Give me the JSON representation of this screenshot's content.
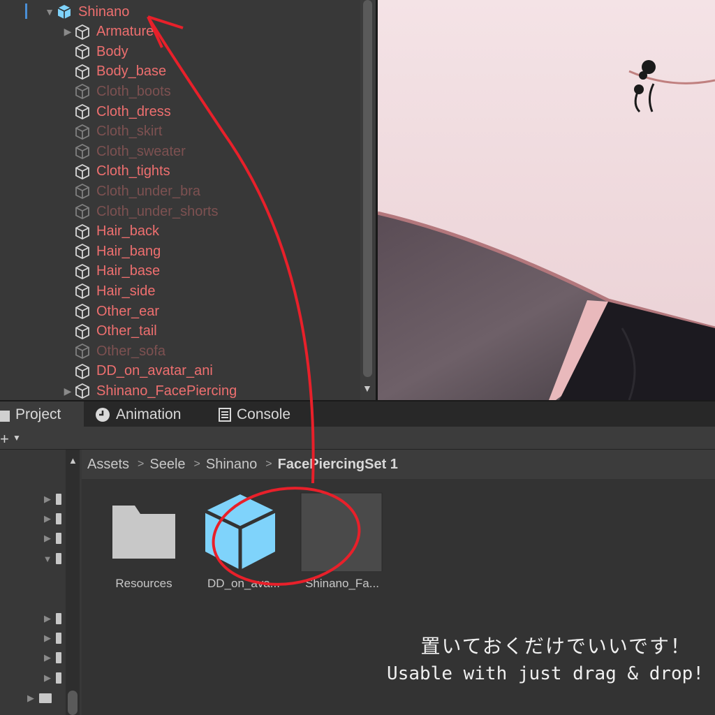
{
  "hierarchy": {
    "items": [
      {
        "label": "Shinano",
        "state": "root",
        "arrow": "down",
        "indent": 0
      },
      {
        "label": "Armature",
        "state": "active",
        "arrow": "right",
        "indent": 1
      },
      {
        "label": "Body",
        "state": "active",
        "arrow": "",
        "indent": 1
      },
      {
        "label": "Body_base",
        "state": "active",
        "arrow": "",
        "indent": 1
      },
      {
        "label": "Cloth_boots",
        "state": "inactive",
        "arrow": "",
        "indent": 1
      },
      {
        "label": "Cloth_dress",
        "state": "active",
        "arrow": "",
        "indent": 1
      },
      {
        "label": "Cloth_skirt",
        "state": "inactive",
        "arrow": "",
        "indent": 1
      },
      {
        "label": "Cloth_sweater",
        "state": "inactive",
        "arrow": "",
        "indent": 1
      },
      {
        "label": "Cloth_tights",
        "state": "active",
        "arrow": "",
        "indent": 1
      },
      {
        "label": "Cloth_under_bra",
        "state": "inactive",
        "arrow": "",
        "indent": 1
      },
      {
        "label": "Cloth_under_shorts",
        "state": "inactive",
        "arrow": "",
        "indent": 1
      },
      {
        "label": "Hair_back",
        "state": "active",
        "arrow": "",
        "indent": 1
      },
      {
        "label": "Hair_bang",
        "state": "active",
        "arrow": "",
        "indent": 1
      },
      {
        "label": "Hair_base",
        "state": "active",
        "arrow": "",
        "indent": 1
      },
      {
        "label": "Hair_side",
        "state": "active",
        "arrow": "",
        "indent": 1
      },
      {
        "label": "Other_ear",
        "state": "active",
        "arrow": "",
        "indent": 1
      },
      {
        "label": "Other_tail",
        "state": "active",
        "arrow": "",
        "indent": 1
      },
      {
        "label": "Other_sofa",
        "state": "inactive",
        "arrow": "",
        "indent": 1
      },
      {
        "label": "DD_on_avatar_ani",
        "state": "active",
        "arrow": "",
        "indent": 1
      },
      {
        "label": "Shinano_FacePiercing",
        "state": "active",
        "arrow": "right",
        "indent": 1
      }
    ]
  },
  "tabs": [
    {
      "label": "Project",
      "icon": "folder-icon"
    },
    {
      "label": "Animation",
      "icon": "clock-icon"
    },
    {
      "label": "Console",
      "icon": "console-icon"
    }
  ],
  "breadcrumb": [
    "Assets",
    "Seele",
    "Shinano",
    "FacePiercingSet 1"
  ],
  "assets": [
    {
      "name": "Resources",
      "icon": "folder-icon"
    },
    {
      "name": "DD_on_ava...",
      "icon": "prefab-cube-icon"
    },
    {
      "name": "Shinano_Fa...",
      "icon": "prefab-thumbnail"
    }
  ],
  "caption": {
    "japanese": "置いておくだけでいいです！",
    "english": "Usable with just drag & drop!"
  },
  "colors": {
    "annotation_red": "#e8202a",
    "active_label": "#ee6f6f",
    "inactive_label": "#7d5151",
    "cube_blue": "#7fd3fb"
  }
}
